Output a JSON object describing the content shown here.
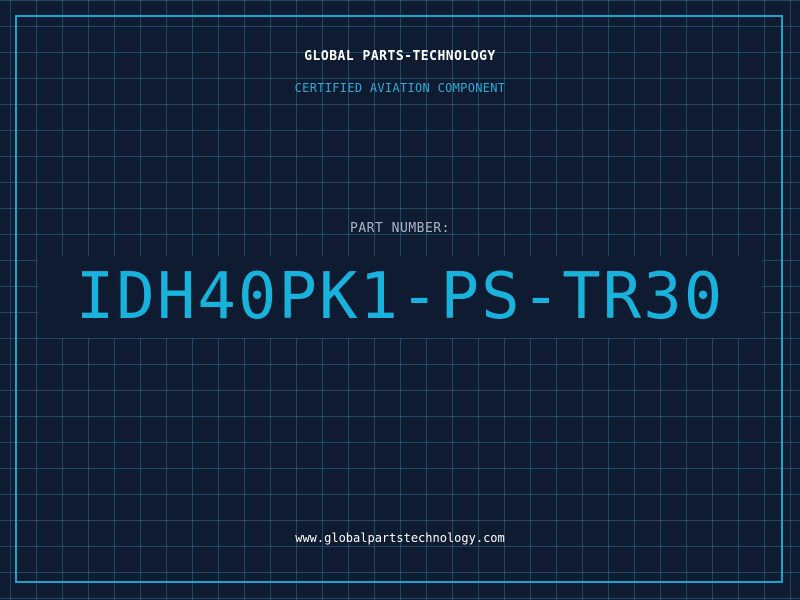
{
  "company": "GLOBAL PARTS-TECHNOLOGY",
  "subtitle": "CERTIFIED AVIATION COMPONENT",
  "part_label": "PART NUMBER:",
  "part_number": "IDH40PK1-PS-TR30",
  "website": "www.globalpartstechnology.com",
  "colors": {
    "background": "#0f1b30",
    "grid": "#286e8c",
    "frame": "#1aa3cc",
    "accent": "#19b2dc",
    "label": "#a9b6c7",
    "text": "#ffffff"
  }
}
